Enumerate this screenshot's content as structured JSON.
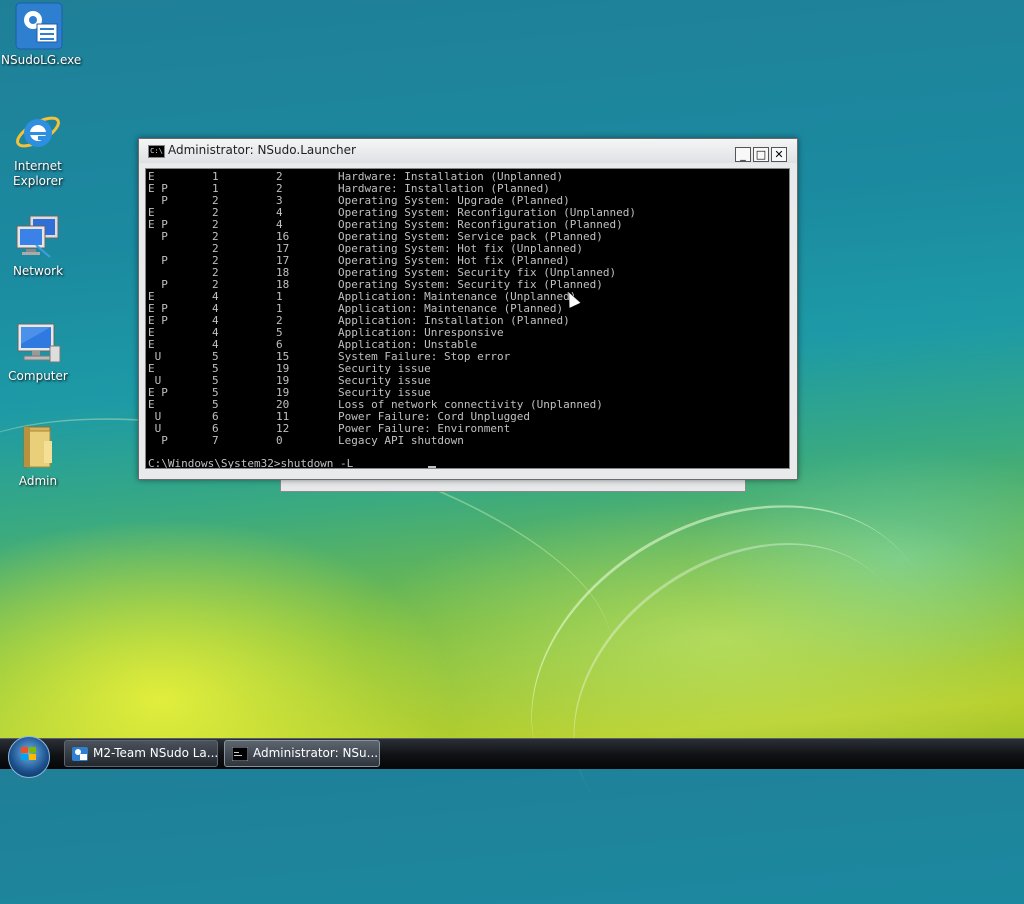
{
  "desktop": {
    "icons": [
      {
        "label": "NSudoLG.exe",
        "icon": "nsudo-app-icon"
      },
      {
        "label": "Internet Explorer",
        "icon": "internet-explorer-icon"
      },
      {
        "label": "Network",
        "icon": "network-icon"
      },
      {
        "label": "Computer",
        "icon": "computer-icon"
      },
      {
        "label": "Admin",
        "icon": "user-folder-icon"
      }
    ]
  },
  "window": {
    "title": "Administrator: NSudo.Launcher",
    "icon_label": "C:\\",
    "buttons": {
      "minimize": "_",
      "maximize": "□",
      "close": "✕"
    },
    "rows": [
      {
        "flags": "E",
        "major": "1",
        "minor": "2",
        "reason": "Hardware: Installation (Unplanned)"
      },
      {
        "flags": "E P",
        "major": "1",
        "minor": "2",
        "reason": "Hardware: Installation (Planned)"
      },
      {
        "flags": "  P",
        "major": "2",
        "minor": "3",
        "reason": "Operating System: Upgrade (Planned)"
      },
      {
        "flags": "E",
        "major": "2",
        "minor": "4",
        "reason": "Operating System: Reconfiguration (Unplanned)"
      },
      {
        "flags": "E P",
        "major": "2",
        "minor": "4",
        "reason": "Operating System: Reconfiguration (Planned)"
      },
      {
        "flags": "  P",
        "major": "2",
        "minor": "16",
        "reason": "Operating System: Service pack (Planned)"
      },
      {
        "flags": "",
        "major": "2",
        "minor": "17",
        "reason": "Operating System: Hot fix (Unplanned)"
      },
      {
        "flags": "  P",
        "major": "2",
        "minor": "17",
        "reason": "Operating System: Hot fix (Planned)"
      },
      {
        "flags": "",
        "major": "2",
        "minor": "18",
        "reason": "Operating System: Security fix (Unplanned)"
      },
      {
        "flags": "  P",
        "major": "2",
        "minor": "18",
        "reason": "Operating System: Security fix (Planned)"
      },
      {
        "flags": "E",
        "major": "4",
        "minor": "1",
        "reason": "Application: Maintenance (Unplanned)"
      },
      {
        "flags": "E P",
        "major": "4",
        "minor": "1",
        "reason": "Application: Maintenance (Planned)"
      },
      {
        "flags": "E P",
        "major": "4",
        "minor": "2",
        "reason": "Application: Installation (Planned)"
      },
      {
        "flags": "E",
        "major": "4",
        "minor": "5",
        "reason": "Application: Unresponsive"
      },
      {
        "flags": "E",
        "major": "4",
        "minor": "6",
        "reason": "Application: Unstable"
      },
      {
        "flags": " U",
        "major": "5",
        "minor": "15",
        "reason": "System Failure: Stop error"
      },
      {
        "flags": "E",
        "major": "5",
        "minor": "19",
        "reason": "Security issue"
      },
      {
        "flags": " U",
        "major": "5",
        "minor": "19",
        "reason": "Security issue"
      },
      {
        "flags": "E P",
        "major": "5",
        "minor": "19",
        "reason": "Security issue"
      },
      {
        "flags": "E",
        "major": "5",
        "minor": "20",
        "reason": "Loss of network connectivity (Unplanned)"
      },
      {
        "flags": " U",
        "major": "6",
        "minor": "11",
        "reason": "Power Failure: Cord Unplugged"
      },
      {
        "flags": " U",
        "major": "6",
        "minor": "12",
        "reason": "Power Failure: Environment"
      },
      {
        "flags": "  P",
        "major": "7",
        "minor": "0",
        "reason": "Legacy API shutdown"
      }
    ],
    "prompt": "C:\\Windows\\System32>shutdown -L"
  },
  "taskbar": {
    "start_icon": "windows-start-orb-icon",
    "tasks": [
      {
        "label": "M2-Team NSudo La...",
        "icon": "nsudo-app-icon",
        "active": false
      },
      {
        "label": "Administrator: NSu...",
        "icon": "console-icon",
        "active": true
      }
    ]
  },
  "colors": {
    "console_bg": "#000000",
    "console_text": "#c0c0c0",
    "taskbar": "#111418"
  }
}
